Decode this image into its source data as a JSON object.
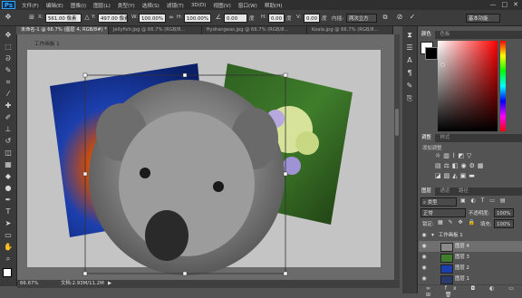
{
  "app": {
    "logo": "Ps"
  },
  "menu": [
    "文件(F)",
    "编辑(E)",
    "图像(I)",
    "图层(L)",
    "类型(Y)",
    "选择(S)",
    "滤镜(T)",
    "3D(D)",
    "视图(V)",
    "窗口(W)",
    "帮助(H)"
  ],
  "window_controls": {
    "minimize": "—",
    "maximize": "□",
    "close": "✕"
  },
  "options": {
    "x_label": "X:",
    "x_value": "561.00 像素",
    "y_label": "Y:",
    "y_value": "497.00 像素",
    "w_label": "W:",
    "w_value": "100.00%",
    "h_label": "H:",
    "h_value": "100.00%",
    "angle_value": "0.00",
    "angle_unit": "度",
    "h_skew_label": "H:",
    "h_skew_value": "0.00",
    "h_skew_unit": "度",
    "v_skew_label": "V:",
    "v_skew_value": "0.00",
    "v_skew_unit": "度",
    "interp_label": "内插:",
    "interp_value": "两次立方",
    "workspace_value": "基本功能"
  },
  "tabs": [
    {
      "label": "未命名-1 @ 66.7% (图层 4, RGB/8#) *",
      "active": true
    },
    {
      "label": "Jellyfish.jpg @ 66.7% (RGB/8...",
      "active": false
    },
    {
      "label": "Hydrangeas.jpg @ 66.7% (RGB/8...",
      "active": false
    },
    {
      "label": "Koala.jpg @ 66.7% (RGB/8...",
      "active": false
    }
  ],
  "canvas": {
    "artboard_label": "工作画板 1"
  },
  "status": {
    "zoom": "66.67%",
    "doc_size": "文档:2.93M/11.2M"
  },
  "color_panel": {
    "tabs": [
      "颜色",
      "色板"
    ],
    "hue_color": "#ff0000"
  },
  "adjust_panel": {
    "tabs": [
      "调整",
      "样式"
    ],
    "subtitle": "添加调整"
  },
  "layers_panel": {
    "tabs": [
      "图层",
      "通道",
      "路径"
    ],
    "kind_label": "类型",
    "blend_mode": "正常",
    "opacity_label": "不透明度:",
    "opacity_value": "100%",
    "lock_label": "锁定:",
    "fill_label": "填充:",
    "fill_value": "100%",
    "group_name": "工作画板 1",
    "layers": [
      {
        "name": "图层 4",
        "selected": true
      },
      {
        "name": "图层 3",
        "selected": false
      },
      {
        "name": "图层 2",
        "selected": false
      },
      {
        "name": "图层 1",
        "selected": false
      }
    ]
  }
}
